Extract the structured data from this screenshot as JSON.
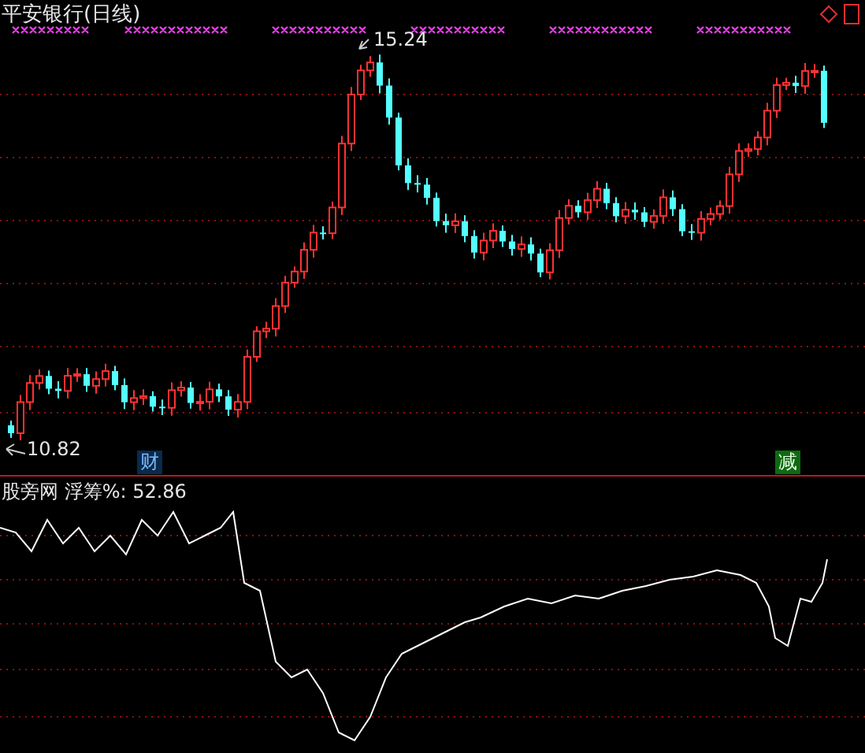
{
  "chart_title": "平安银行(日线)",
  "high_label": "15.24",
  "low_label": "10.82",
  "event_badges": [
    {
      "text": "财",
      "kind": "finance"
    },
    {
      "text": "减",
      "kind": "reduce"
    }
  ],
  "indicator": {
    "label": "股旁网 浮筹%: 52.86"
  }
}
